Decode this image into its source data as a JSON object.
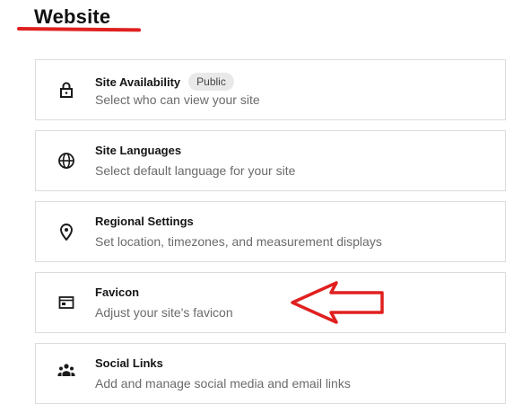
{
  "page": {
    "title": "Website"
  },
  "colors": {
    "underline": "#e0201f",
    "annotation_arrow": "#e0201f"
  },
  "settings": [
    {
      "icon": "lock-icon",
      "title": "Site Availability",
      "badge": "Public",
      "description": "Select who can view your site"
    },
    {
      "icon": "globe-icon",
      "title": "Site Languages",
      "description": "Select default language for your site"
    },
    {
      "icon": "location-pin-icon",
      "title": "Regional Settings",
      "description": "Set location, timezones, and measurement displays"
    },
    {
      "icon": "favicon-icon",
      "title": "Favicon",
      "description": "Adjust your site's favicon"
    },
    {
      "icon": "people-icon",
      "title": "Social Links",
      "description": "Add and manage social media and email links"
    }
  ]
}
